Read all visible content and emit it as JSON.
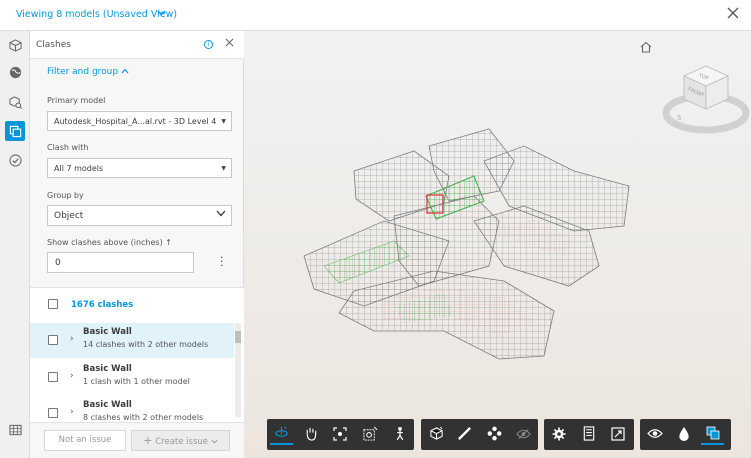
{
  "header": {
    "title": "Viewing 8 models (Unsaved View)",
    "chevron_icon": "chevron-down-icon",
    "close_icon": "close-icon"
  },
  "rail": {
    "items": [
      "cube-icon",
      "globe-icon",
      "model-browser-icon",
      "clashes-icon",
      "check-icon",
      "table-icon"
    ],
    "active": "clashes-icon"
  },
  "panel": {
    "title": "Clashes",
    "filter_group_label": "Filter and group",
    "primary_model_label": "Primary model",
    "primary_model_value": "Autodesk_Hospital_A...al.rvt - 3D Level 4",
    "clash_with_label": "Clash with",
    "clash_with_value": "All 7 models",
    "group_by_label": "Group by",
    "group_by_value": "Object",
    "threshold_label": "Show clashes above (inches) ↑",
    "threshold_value": "0",
    "total_clashes": "1676 clashes",
    "items": [
      {
        "name": "Basic Wall",
        "detail": "14 clashes with 2 other models",
        "selected": true
      },
      {
        "name": "Basic Wall",
        "detail": "1 clash with 1 other model",
        "selected": false
      },
      {
        "name": "Basic Wall",
        "detail": "8 clashes with 2 other models",
        "selected": false
      }
    ],
    "not_issue_label": "Not an issue",
    "create_issue_label": "Create issue"
  },
  "viewer": {
    "view_cube": {
      "top_label": "TOP",
      "front_label": "FRONT",
      "compass_label": "S"
    },
    "toolbar": [
      {
        "icon": "orbit-icon",
        "active": true
      },
      {
        "icon": "pan-icon"
      },
      {
        "icon": "fit-to-view-icon"
      },
      {
        "icon": "camera-interactions-icon"
      },
      {
        "icon": "first-person-icon"
      },
      {
        "icon": "section-analysis-icon"
      },
      {
        "icon": "measure-icon"
      },
      {
        "icon": "explode-model-icon"
      },
      {
        "icon": "ghosting-icon",
        "disabled": true
      },
      {
        "icon": "settings-icon"
      },
      {
        "icon": "properties-icon"
      },
      {
        "icon": "full-screen-icon"
      },
      {
        "icon": "visibility-icon"
      },
      {
        "icon": "object-isolation-icon"
      },
      {
        "icon": "clash-view-icon",
        "active": true
      }
    ]
  },
  "colors": {
    "accent": "#0696d7",
    "toolbar_bg": "#323232",
    "clash_green": "#3fae48",
    "clash_red": "#d94040"
  }
}
